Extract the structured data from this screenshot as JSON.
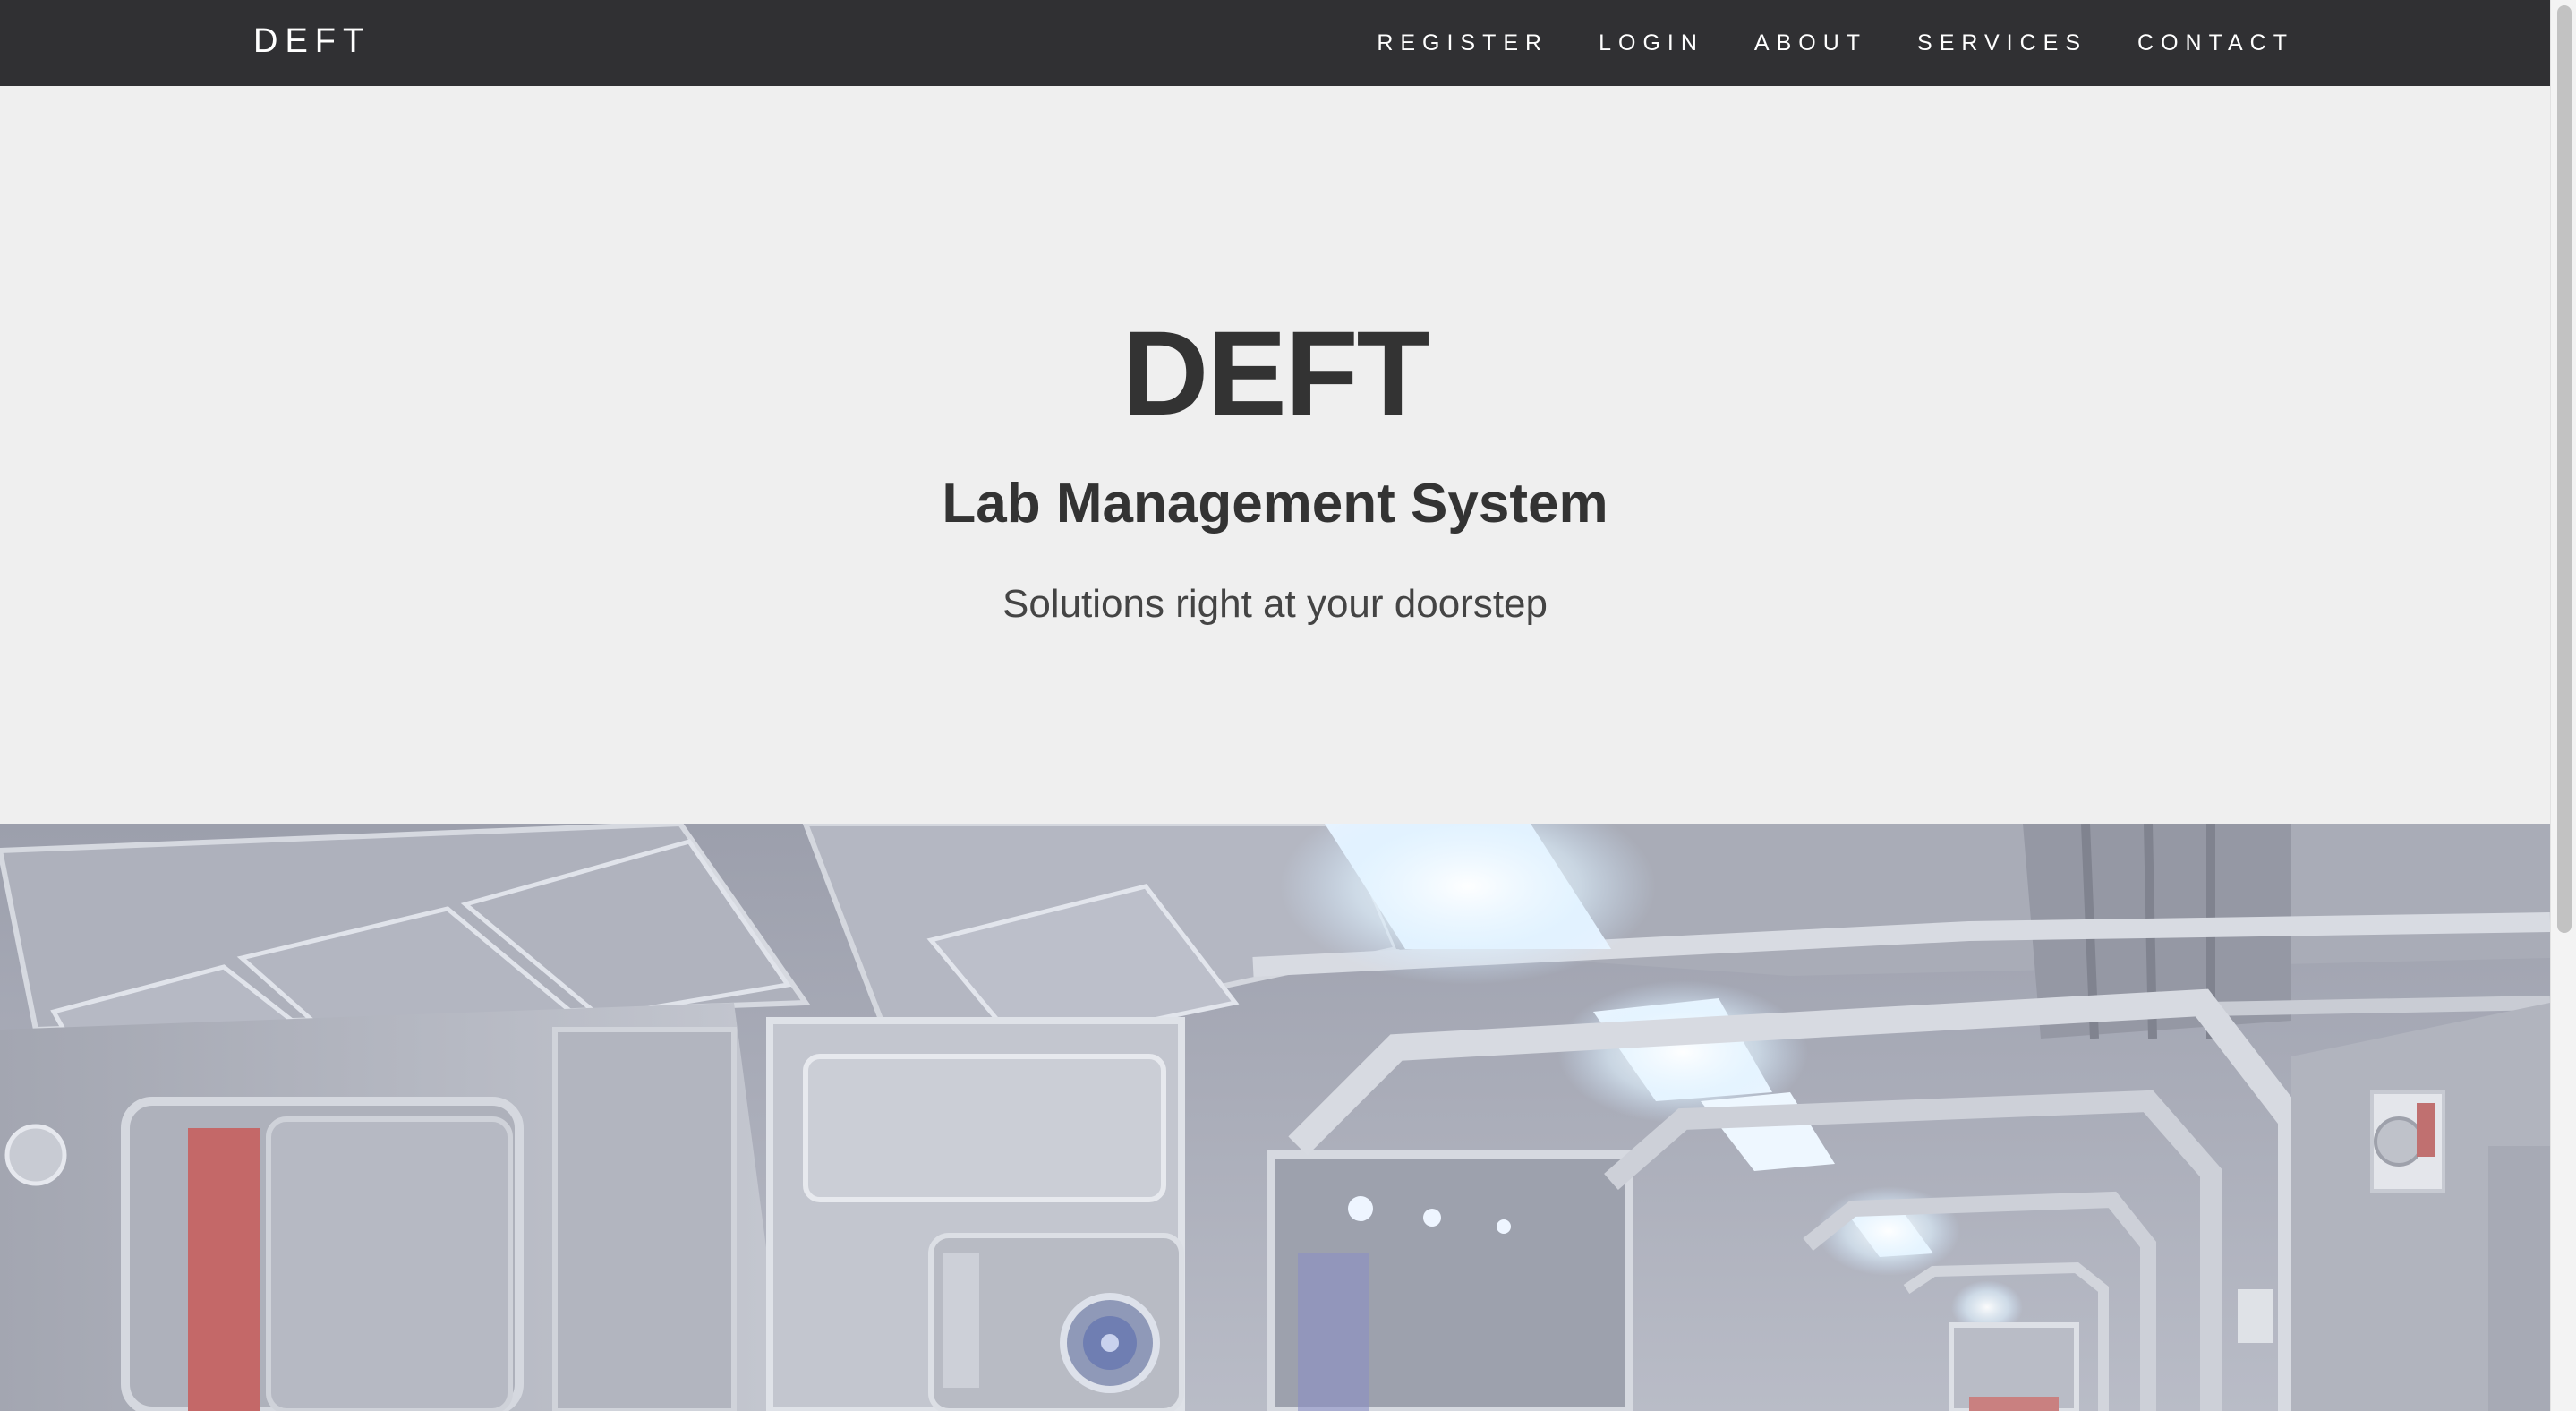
{
  "navbar": {
    "brand": "DEFT",
    "links": [
      "REGISTER",
      "LOGIN",
      "ABOUT",
      "SERVICES",
      "CONTACT"
    ]
  },
  "hero": {
    "title": "DEFT",
    "subtitle": "Lab Management System",
    "tagline": "Solutions right at your doorstep"
  },
  "banner": {
    "image": "sci-fi-lab-corridor-image"
  },
  "colors": {
    "navbar_bg": "#303033",
    "hero_bg": "#efefef",
    "text_dark": "#333333"
  }
}
